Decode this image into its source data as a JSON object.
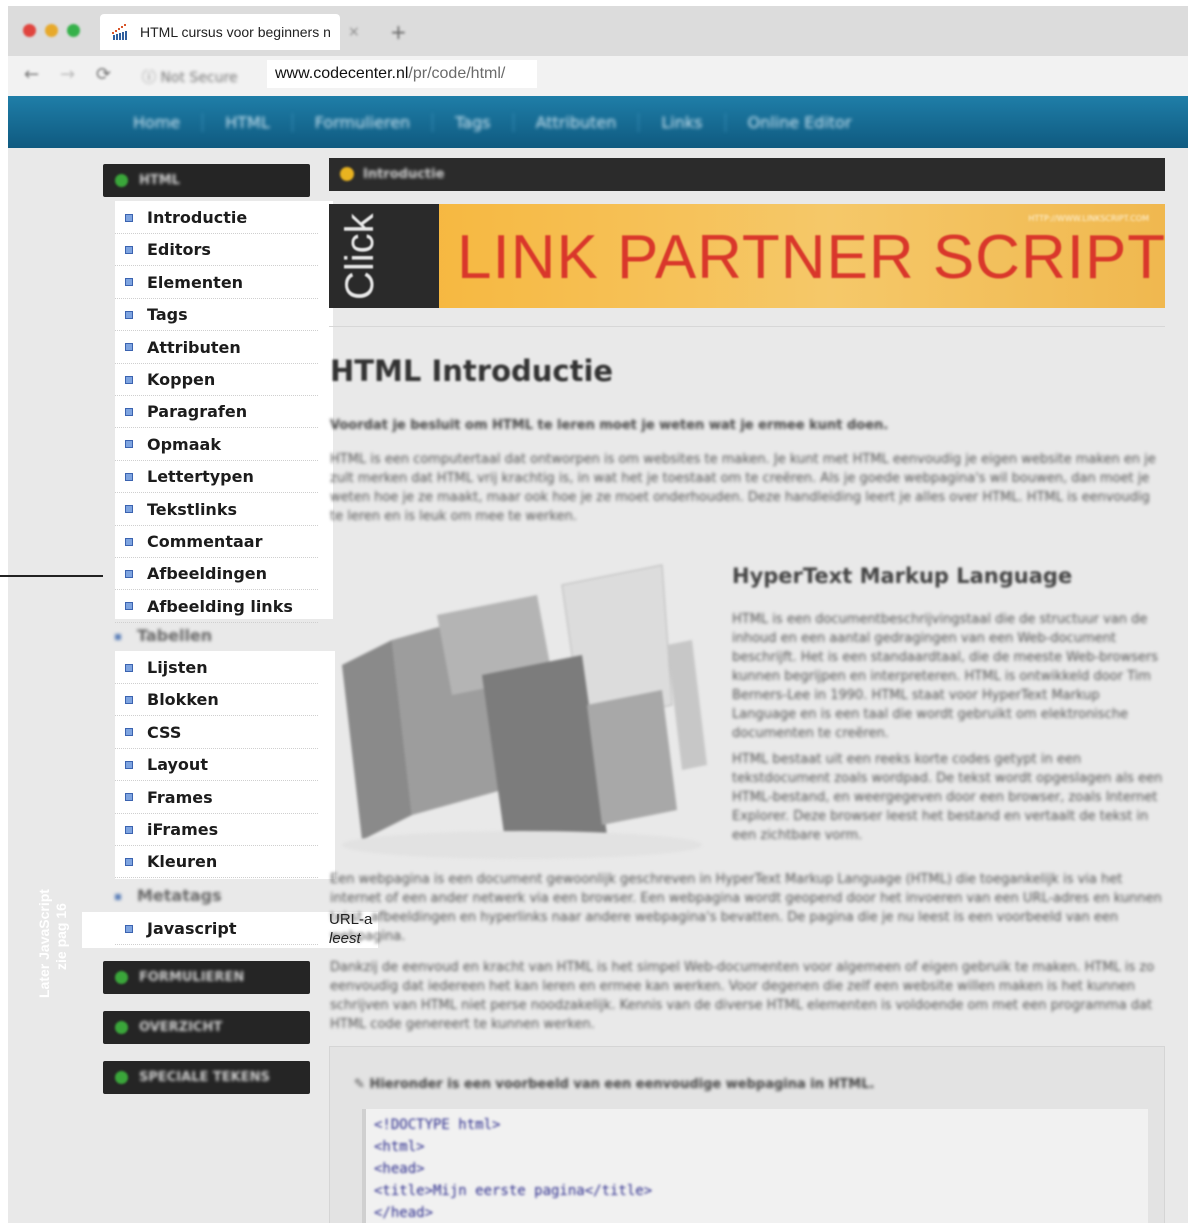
{
  "browser": {
    "tab_title": "HTML cursus voor beginners n",
    "security_label": "Not Secure",
    "url_host": "www.codecenter.nl",
    "url_path": "/pr/code/html/",
    "close_glyph": "×",
    "new_tab_glyph": "+"
  },
  "site_nav": [
    "Home",
    "HTML",
    "Formulieren",
    "Tags",
    "Attributen",
    "Links",
    "Online Editor"
  ],
  "sidebar": {
    "html_header": "HTML",
    "menu_group_1": [
      "Introductie",
      "Editors",
      "Elementen",
      "Tags",
      "Attributen",
      "Koppen",
      "Paragrafen",
      "Opmaak",
      "Lettertypen",
      "Tekstlinks",
      "Commentaar",
      "Afbeeldingen",
      "Afbeelding links"
    ],
    "tabellen": "Tabellen",
    "menu_group_2": [
      "Lijsten",
      "Blokken",
      "CSS",
      "Layout",
      "Frames",
      "iFrames",
      "Kleuren"
    ],
    "metatags": "Metatags",
    "javascript": "Javascript",
    "formulieren_header": "FORMULIEREN",
    "overzicht_header": "OVERZICHT",
    "speciale_header": "SPECIALE TEKENS",
    "annotation_line1": "Later JavaScript",
    "annotation_line2": "zie pag 16"
  },
  "content": {
    "header_label": "Introductie",
    "banner_click": "Click Here",
    "banner_title": "LINK PARTNER SCRIPT",
    "banner_small": "HTTP://WWW.LINKSCRIPT.COM",
    "page_title": "HTML Introductie",
    "lead": "Voordat je besluit om HTML te leren moet je weten wat je ermee kunt doen.",
    "p1": "HTML is een computertaal dat ontworpen is om websites te maken. Je kunt met HTML eenvoudig je eigen website maken en je zult merken dat HTML vrij krachtig is, in wat het je toestaat om te creëren. Als je goede webpagina's wil bouwen, dan moet je weten hoe je ze maakt, maar ook hoe je ze moet onderhouden. Deze handleiding leert je alles over HTML. HTML is eenvoudig te leren en is leuk om mee te werken.",
    "subtitle": "HyperText Markup Language",
    "p2": "HTML is een documentbeschrijvingstaal die de structuur van de inhoud en een aantal gedragingen van een Web-document beschrijft. Het is een standaardtaal, die de meeste Web-browsers kunnen begrijpen en interpreteren. HTML is ontwikkeld door Tim Berners-Lee in 1990. HTML staat voor HyperText Markup Language en is een taal die wordt gebruikt om elektronische documenten te creëren.",
    "p3": "HTML bestaat uit een reeks korte codes getypt in een tekstdocument zoals wordpad. De tekst wordt opgeslagen als een HTML-bestand, en weergegeven door een browser, zoals Internet Explorer. Deze browser leest het bestand en vertaalt de tekst in een zichtbare vorm.",
    "p4": "Een webpagina is een document gewoonlijk geschreven in HyperText Markup Language (HTML) die toegankelijk is via het internet of een ander netwerk via een browser. Een webpagina wordt geopend door het invoeren van een URL-adres en kunnen tekst, afbeeldingen en hyperlinks naar andere webpagina's bevatten. De pagina die je nu leest is een voorbeeld van een webpagina.",
    "p5": "Dankzij de eenvoud en kracht van HTML is het simpel Web-documenten voor algemeen of eigen gebruik te maken. HTML is zo eenvoudig dat iedereen het kan leren en ermee kan werken. Voor degenen die zelf een website willen maken is het kunnen schrijven van HTML niet perse noodzakelijk. Kennis van de diverse HTML elementen is voldoende om met een programma dat HTML code genereert te kunnen werken.",
    "urla_line1": "URL-a",
    "urla_line2": "leest",
    "code_note": "Hieronder is een voorbeeld van een eenvoudige webpagina in HTML.",
    "code_lines": [
      "<!DOCTYPE html>",
      "<html>",
      " <head>",
      "  <title>Mijn eerste pagina</title>",
      " </head>"
    ]
  },
  "colors": {
    "nav_blue": "#1f7ea8",
    "menu_bullet": "#7ea4e0",
    "banner_red": "#d9372b",
    "banner_orange": "#f7b436"
  }
}
